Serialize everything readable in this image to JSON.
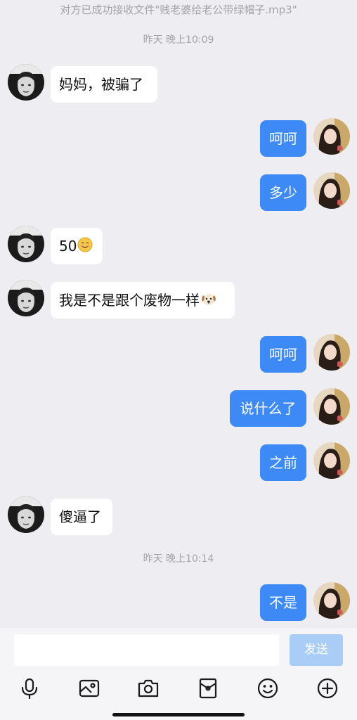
{
  "system_note": "对方已成功接收文件\"贱老婆给老公带绿帽子.mp3\"",
  "timestamps": [
    "昨天 晚上10:09",
    "昨天 晚上10:14"
  ],
  "messages": [
    {
      "side": "in",
      "text": "妈妈，被骗了"
    },
    {
      "side": "out",
      "text": "呵呵"
    },
    {
      "side": "out",
      "text": "多少"
    },
    {
      "side": "in",
      "text": "50",
      "emoji": "smiling-face-icon"
    },
    {
      "side": "in",
      "text": "我是不是跟个废物一样",
      "emoji": "dog-face-icon"
    },
    {
      "side": "out",
      "text": "呵呵"
    },
    {
      "side": "out",
      "text": "说什么了"
    },
    {
      "side": "out",
      "text": "之前"
    },
    {
      "side": "in",
      "text": "傻逼了"
    },
    {
      "side": "out",
      "text": "不是"
    }
  ],
  "composer": {
    "input_value": "",
    "send_label": "发送"
  },
  "toolbar": [
    "microphone-icon",
    "image-icon",
    "camera-icon",
    "red-packet-icon",
    "emoji-icon",
    "add-icon"
  ],
  "colors": {
    "background": "#eeedf2",
    "outgoing_bubble": "#3d8af7",
    "incoming_bubble": "#ffffff",
    "send_button_disabled": "#a9cdf7"
  }
}
